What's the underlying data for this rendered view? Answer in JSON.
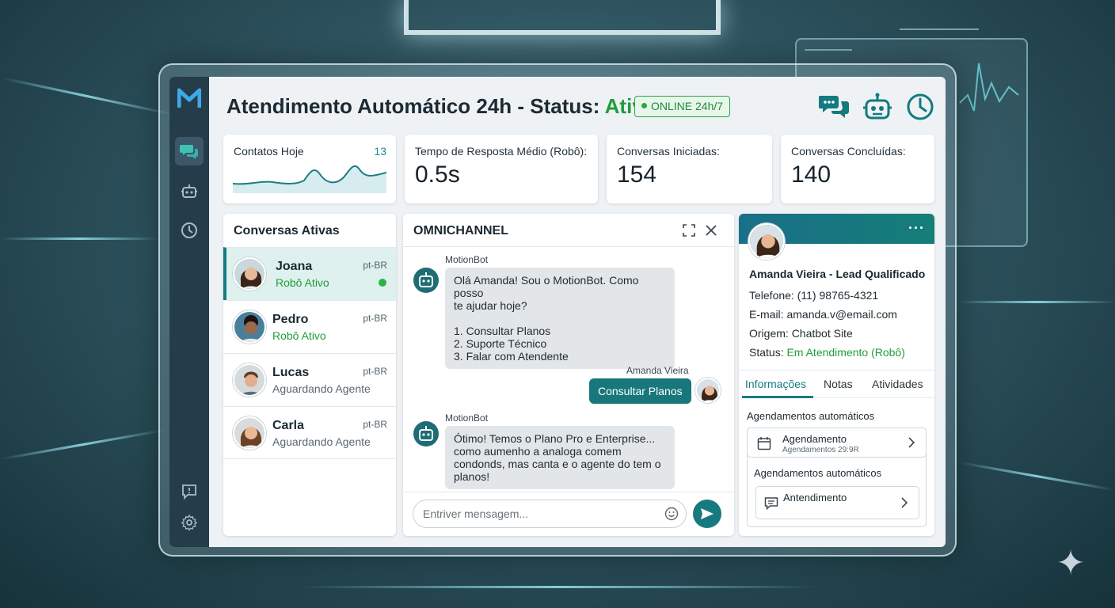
{
  "header": {
    "title_prefix": "Atendimento Automático 24h - Status: ",
    "title_status": "Ativo",
    "online_badge": "ONLINE 24h/7"
  },
  "sidebar": {
    "items": [
      {
        "icon": "chat-icon",
        "active": true
      },
      {
        "icon": "robot-icon",
        "active": false
      },
      {
        "icon": "clock-icon",
        "active": false
      },
      {
        "icon": "feedback-icon",
        "active": false
      },
      {
        "icon": "gear-icon",
        "active": false
      }
    ]
  },
  "stats": [
    {
      "label": "Contatos Hoje",
      "value": "",
      "number": "13"
    },
    {
      "label": "Tempo de Resposta Médio (Robô):",
      "value": "0.5s"
    },
    {
      "label": "Conversas Iniciadas:",
      "value": "154"
    },
    {
      "label": "Conversas Concluídas:",
      "value": "140"
    }
  ],
  "conversations": {
    "title": "Conversas Ativas",
    "items": [
      {
        "name": "Joana",
        "status": "Robô Ativo",
        "lang": "pt-BR",
        "online": true
      },
      {
        "name": "Pedro",
        "status": "Robô Ativo",
        "lang": "pt-BR",
        "online": false
      },
      {
        "name": "Lucas",
        "status": "Aguardando Agente",
        "lang": "pt-BR",
        "online": false
      },
      {
        "name": "Carla",
        "status": "Aguardando Agente",
        "lang": "pt-BR",
        "online": false
      }
    ]
  },
  "chat": {
    "title": "OMNICHANNEL",
    "messages": [
      {
        "sender": "MotionBot",
        "text": "Olá Amanda! Sou o MotionBot. Como posso\nte ajudar hoje?\n\n1. Consultar Planos\n2. Suporte Técnico\n3. Falar com Atendente"
      },
      {
        "sender": "Amanda Vieira",
        "text": "Consultar Planos"
      },
      {
        "sender": "MotionBot",
        "text": "Ótimo! Temos o Plano Pro e Enterprise...\ncomo aumenho a analoga comem\ncondonds, mas canta e o agente do tem o\nplanos!"
      }
    ],
    "input_placeholder": "Entriver mensagem..."
  },
  "lead": {
    "name": "Amanda Vieira - Lead Qualificado",
    "phone_label": "Telefone: ",
    "phone": "(11) 98765-4321",
    "email_label": "E-mail: ",
    "email": "amanda.v@email.com",
    "origin_label": "Origem: ",
    "origin": "Chatbot Site",
    "status_label": "Status: ",
    "status": "Em Atendimento (Robô)",
    "tabs": [
      "Informações",
      "Notas",
      "Atividades"
    ],
    "section_title": "Agendamentos automáticos",
    "row1_title": "Agendamento",
    "row1_sub": "Agendamentos 29:9R",
    "section2_title": "Agendamentos automáticos",
    "row2_title": "Antendimento"
  },
  "colors": {
    "accent": "#177b80",
    "sidebar": "#253d4b",
    "status_green": "#1f9d3a"
  }
}
